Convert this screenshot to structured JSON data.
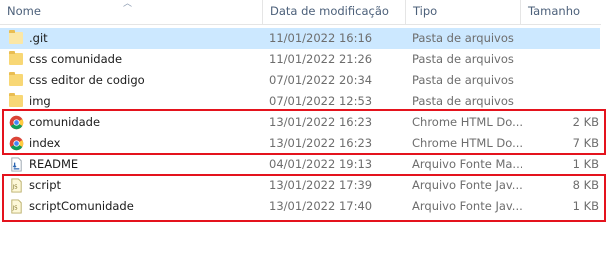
{
  "columns": {
    "name": "Nome",
    "date": "Data de modificação",
    "type": "Tipo",
    "size": "Tamanho"
  },
  "files": [
    {
      "name": ".git",
      "date": "11/01/2022 16:16",
      "type": "Pasta de arquivos",
      "size": "",
      "icon": "folder-icon",
      "selected": true
    },
    {
      "name": "css comunidade",
      "date": "11/01/2022 21:26",
      "type": "Pasta de arquivos",
      "size": "",
      "icon": "folder-icon",
      "selected": false
    },
    {
      "name": "css editor de codigo",
      "date": "07/01/2022 20:34",
      "type": "Pasta de arquivos",
      "size": "",
      "icon": "folder-icon",
      "selected": false
    },
    {
      "name": "img",
      "date": "07/01/2022 12:53",
      "type": "Pasta de arquivos",
      "size": "",
      "icon": "folder-icon",
      "selected": false
    },
    {
      "name": "comunidade",
      "date": "13/01/2022 16:23",
      "type": "Chrome HTML Do...",
      "size": "2 KB",
      "icon": "chrome-icon",
      "selected": false
    },
    {
      "name": "index",
      "date": "13/01/2022 16:23",
      "type": "Chrome HTML Do...",
      "size": "7 KB",
      "icon": "chrome-icon",
      "selected": false
    },
    {
      "name": "README",
      "date": "04/01/2022 19:13",
      "type": "Arquivo Fonte Ma...",
      "size": "1 KB",
      "icon": "markdown-file-icon",
      "selected": false
    },
    {
      "name": "script",
      "date": "13/01/2022 17:39",
      "type": "Arquivo Fonte Jav...",
      "size": "8 KB",
      "icon": "js-file-icon",
      "selected": false
    },
    {
      "name": "scriptComunidade",
      "date": "13/01/2022 17:40",
      "type": "Arquivo Fonte Jav...",
      "size": "1 KB",
      "icon": "js-file-icon",
      "selected": false
    }
  ],
  "colors": {
    "highlight_border": "#e4131d",
    "selection": "#cce8ff",
    "folder": "#f8d775"
  }
}
